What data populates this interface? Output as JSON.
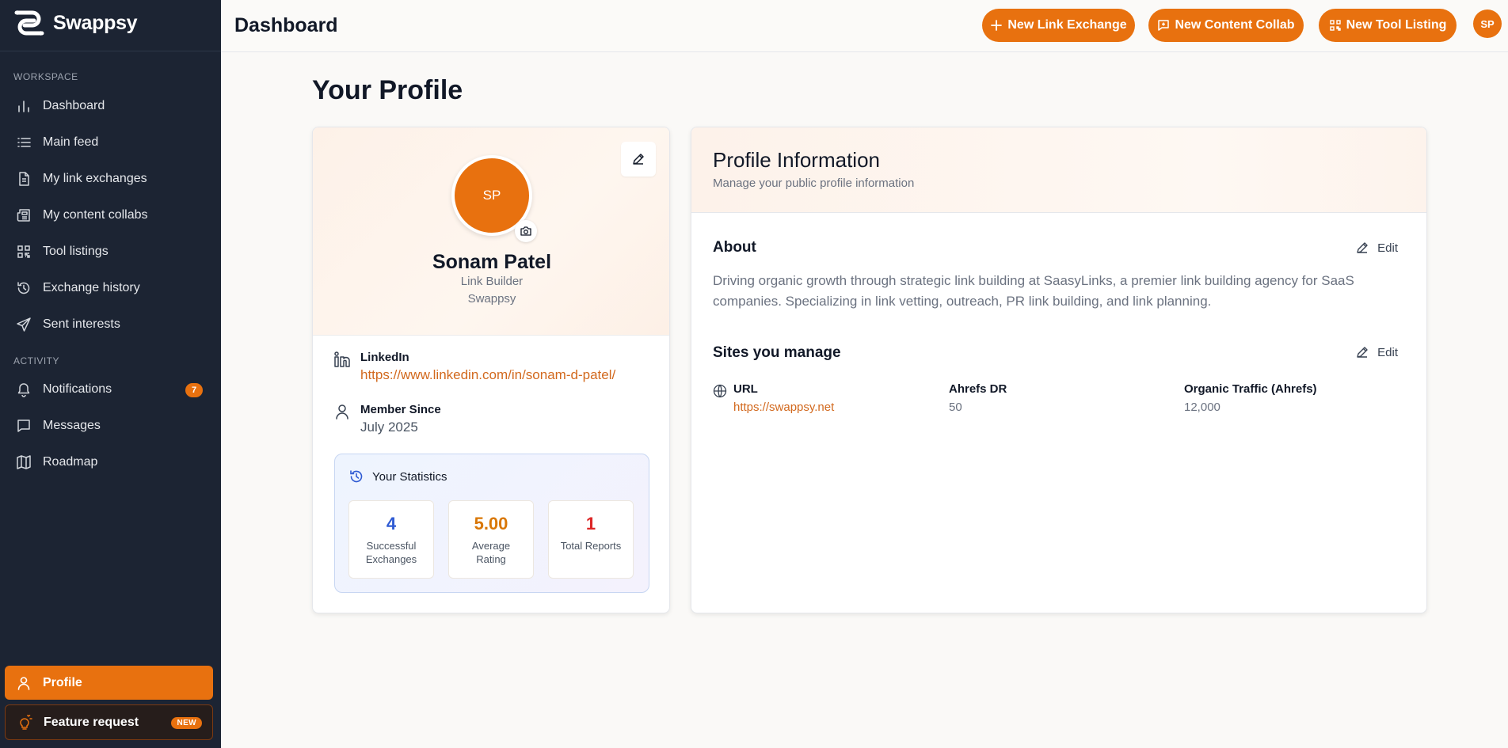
{
  "app": {
    "name": "Swappsy"
  },
  "sidebar": {
    "workspace_label": "WORKSPACE",
    "workspace_items": [
      {
        "label": "Dashboard",
        "icon": "bar-chart-icon"
      },
      {
        "label": "Main feed",
        "icon": "list-icon"
      },
      {
        "label": "My link exchanges",
        "icon": "document-icon"
      },
      {
        "label": "My content collabs",
        "icon": "newspaper-icon"
      },
      {
        "label": "Tool listings",
        "icon": "qr-grid-icon"
      },
      {
        "label": "Exchange history",
        "icon": "history-icon"
      },
      {
        "label": "Sent interests",
        "icon": "send-icon"
      }
    ],
    "activity_label": "ACTIVITY",
    "activity_items": [
      {
        "label": "Notifications",
        "icon": "bell-icon",
        "badge": "7"
      },
      {
        "label": "Messages",
        "icon": "message-icon"
      },
      {
        "label": "Roadmap",
        "icon": "map-icon"
      }
    ],
    "profile_label": "Profile",
    "feature_label": "Feature request",
    "feature_badge": "NEW"
  },
  "header": {
    "title": "Dashboard",
    "buttons": [
      "New Link Exchange",
      "New Content Collab",
      "New Tool Listing"
    ],
    "avatar_initials": "SP"
  },
  "page": {
    "title": "Your Profile"
  },
  "profile": {
    "initials": "SP",
    "name": "Sonam Patel",
    "role": "Link Builder",
    "company": "Swappsy",
    "linkedin_label": "LinkedIn",
    "linkedin_url": "https://www.linkedin.com/in/sonam-d-patel/",
    "member_label": "Member Since",
    "member_value": "July 2025",
    "stats_title": "Your Statistics",
    "stats": [
      {
        "value": "4",
        "label": "Successful Exchanges",
        "color": "#2f5bd3"
      },
      {
        "value": "5.00",
        "label": "Average Rating",
        "color": "#d97706"
      },
      {
        "value": "1",
        "label": "Total Reports",
        "color": "#dc2626"
      }
    ]
  },
  "info": {
    "title": "Profile Information",
    "subtitle": "Manage your public profile information",
    "about_title": "About",
    "edit_label": "Edit",
    "about_text": "Driving organic growth through strategic link building at SaasyLinks, a premier link building agency for SaaS companies. Specializing in link vetting, outreach, PR link building, and link planning.",
    "sites_title": "Sites you manage",
    "site_columns": [
      {
        "header": "URL",
        "value": "https://swappsy.net"
      },
      {
        "header": "Ahrefs DR",
        "value": "50"
      },
      {
        "header": "Organic Traffic (Ahrefs)",
        "value": "12,000"
      }
    ]
  },
  "colors": {
    "accent": "#e8710f",
    "sidebar_bg": "#1c2433"
  }
}
